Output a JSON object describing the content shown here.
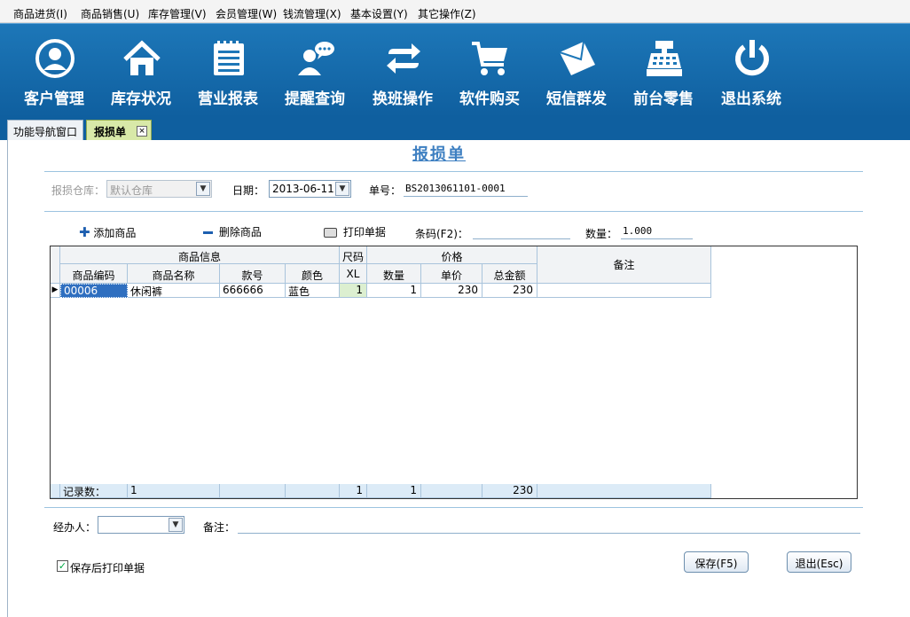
{
  "menu": [
    {
      "label": "商品进货(I)"
    },
    {
      "label": "商品销售(U)"
    },
    {
      "label": "库存管理(V)"
    },
    {
      "label": "会员管理(W)"
    },
    {
      "label": "钱流管理(X)"
    },
    {
      "label": "基本设置(Y)"
    },
    {
      "label": "其它操作(Z)"
    }
  ],
  "toolbar": [
    {
      "label": "客户管理",
      "icon": "customer-icon"
    },
    {
      "label": "库存状况",
      "icon": "home-icon"
    },
    {
      "label": "营业报表",
      "icon": "report-icon"
    },
    {
      "label": "提醒查询",
      "icon": "reminder-icon"
    },
    {
      "label": "换班操作",
      "icon": "shift-icon"
    },
    {
      "label": "软件购买",
      "icon": "cart-icon"
    },
    {
      "label": "短信群发",
      "icon": "mail-icon"
    },
    {
      "label": "前台零售",
      "icon": "cash-register-icon"
    },
    {
      "label": "退出系统",
      "icon": "power-icon"
    }
  ],
  "tabs": [
    {
      "label": "功能导航窗口"
    },
    {
      "label": "报损单",
      "close": "×"
    }
  ],
  "form": {
    "title": "报损单",
    "warehouse_label": "报损仓库：",
    "warehouse_value": "默认仓库",
    "date_label": "日期：",
    "date_value": "2013-06-11",
    "order_no_label": "单号：",
    "order_no_value": "BS2013061101-0001"
  },
  "actions": {
    "add": "添加商品",
    "delete": "删除商品",
    "print": "打印单据",
    "barcode_label": "条码(F2)：",
    "barcode_value": "",
    "qty_label": "数量：",
    "qty_value": "1.000"
  },
  "grid": {
    "group_headers": {
      "info": "商品信息",
      "size": "尺码",
      "price": "价格",
      "remark": "备注"
    },
    "headers": {
      "code": "商品编码",
      "name": "商品名称",
      "style": "款号",
      "color": "颜色",
      "size": "XL",
      "qty": "数量",
      "unit_price": "单价",
      "total": "总金额"
    },
    "rows": [
      {
        "code": "00006",
        "name": "休闲裤",
        "style": "666666",
        "color": "蓝色",
        "size": "1",
        "qty": "1",
        "unit_price": "230",
        "total": "230",
        "remark": ""
      }
    ],
    "footer": {
      "label": "记录数：",
      "count": "1",
      "size": "1",
      "qty": "1",
      "total": "230"
    }
  },
  "bottom": {
    "handler_label": "经办人：",
    "handler_value": "",
    "remark_label": "备注：",
    "remark_value": "",
    "print_after_save": "保存后打印单据",
    "save": "保存(F5)",
    "exit": "退出(Esc)"
  },
  "colors": {
    "toolbar": "#1d77b8",
    "accent": "#3d7fc1"
  }
}
